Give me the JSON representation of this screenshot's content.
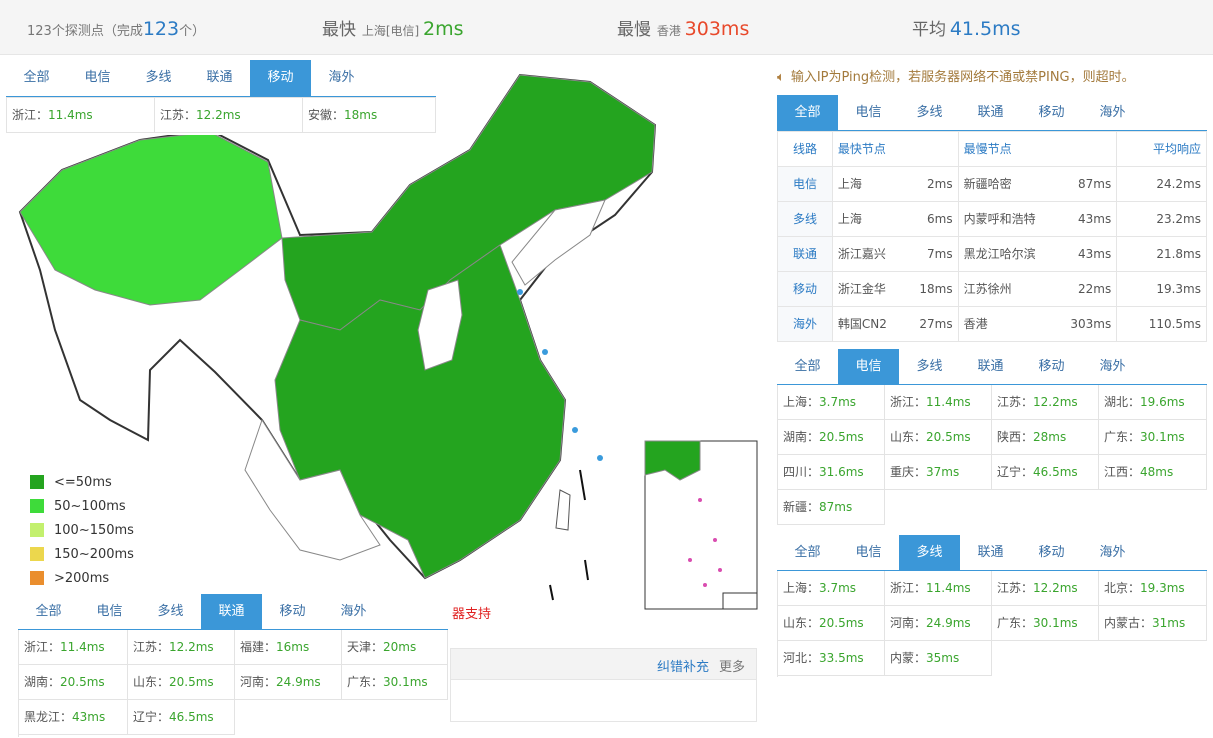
{
  "summary": {
    "probe_prefix": "123个探测点（完成",
    "probe_count": "123",
    "probe_suffix": "个）",
    "fastest_label": "最快",
    "fastest_loc": "上海[电信]",
    "fastest_val": "2ms",
    "slowest_label": "最慢",
    "slowest_loc": "香港",
    "slowest_val": "303ms",
    "avg_label": "平均",
    "avg_val": "41.5ms"
  },
  "tab_labels": [
    "全部",
    "电信",
    "多线",
    "联通",
    "移动",
    "海外"
  ],
  "mobile_panel": {
    "cells": [
      [
        "浙江：",
        "11.4ms"
      ],
      [
        "江苏：",
        "12.2ms"
      ],
      [
        "安徽：",
        "18ms"
      ]
    ]
  },
  "notice": "输入IP为Ping检测，若服务器网络不通或禁PING，则超时。",
  "stats": {
    "headers": [
      "线路",
      "最快节点",
      "最慢节点",
      "平均响应"
    ],
    "rows": [
      {
        "line": "电信",
        "fast": "上海",
        "fast_v": "2ms",
        "slow": "新疆哈密",
        "slow_v": "87ms",
        "avg": "24.2ms"
      },
      {
        "line": "多线",
        "fast": "上海",
        "fast_v": "6ms",
        "slow": "内蒙呼和浩特",
        "slow_v": "43ms",
        "avg": "23.2ms"
      },
      {
        "line": "联通",
        "fast": "浙江嘉兴",
        "fast_v": "7ms",
        "slow": "黑龙江哈尔滨",
        "slow_v": "43ms",
        "avg": "21.8ms"
      },
      {
        "line": "移动",
        "fast": "浙江金华",
        "fast_v": "18ms",
        "slow": "江苏徐州",
        "slow_v": "22ms",
        "avg": "19.3ms"
      },
      {
        "line": "海外",
        "fast": "韩国CN2",
        "fast_v": "27ms",
        "slow": "香港",
        "slow_v": "303ms",
        "avg": "110.5ms"
      }
    ]
  },
  "telecom_panel": {
    "cells": [
      [
        "上海：",
        "3.7ms"
      ],
      [
        "浙江：",
        "11.4ms"
      ],
      [
        "江苏：",
        "12.2ms"
      ],
      [
        "湖北：",
        "19.6ms"
      ],
      [
        "湖南：",
        "20.5ms"
      ],
      [
        "山东：",
        "20.5ms"
      ],
      [
        "陕西：",
        "28ms"
      ],
      [
        "广东：",
        "30.1ms"
      ],
      [
        "四川：",
        "31.6ms"
      ],
      [
        "重庆：",
        "37ms"
      ],
      [
        "辽宁：",
        "46.5ms"
      ],
      [
        "江西：",
        "48ms"
      ],
      [
        "新疆：",
        "87ms"
      ]
    ]
  },
  "multi_panel": {
    "cells": [
      [
        "上海：",
        "3.7ms"
      ],
      [
        "浙江：",
        "11.4ms"
      ],
      [
        "江苏：",
        "12.2ms"
      ],
      [
        "北京：",
        "19.3ms"
      ],
      [
        "山东：",
        "20.5ms"
      ],
      [
        "河南：",
        "24.9ms"
      ],
      [
        "广东：",
        "30.1ms"
      ],
      [
        "内蒙古：",
        "31ms"
      ],
      [
        "河北：",
        "33.5ms"
      ],
      [
        "内蒙：",
        "35ms"
      ]
    ]
  },
  "unicom_panel": {
    "cells": [
      [
        "浙江：",
        "11.4ms"
      ],
      [
        "江苏：",
        "12.2ms"
      ],
      [
        "福建：",
        "16ms"
      ],
      [
        "天津：",
        "20ms"
      ],
      [
        "湖南：",
        "20.5ms"
      ],
      [
        "山东：",
        "20.5ms"
      ],
      [
        "河南：",
        "24.9ms"
      ],
      [
        "广东：",
        "30.1ms"
      ],
      [
        "黑龙江：",
        "43ms"
      ],
      [
        "辽宁：",
        "46.5ms"
      ]
    ]
  },
  "legend": [
    {
      "label": "<=50ms",
      "color": "#24a41f"
    },
    {
      "label": "50~100ms",
      "color": "#3edb3a"
    },
    {
      "label": "100~150ms",
      "color": "#c3f06e"
    },
    {
      "label": "150~200ms",
      "color": "#ecd74d"
    },
    {
      "label": ">200ms",
      "color": "#ea8e2e"
    }
  ],
  "map_colors": {
    "dark": "#24a41f",
    "light": "#3edb3a",
    "empty": "#ffffff",
    "border": "#888888",
    "sea": "#3a9bdc"
  },
  "sponsor_partial": "器支持",
  "footer": {
    "correct": "纠错补充",
    "more": "更多"
  }
}
